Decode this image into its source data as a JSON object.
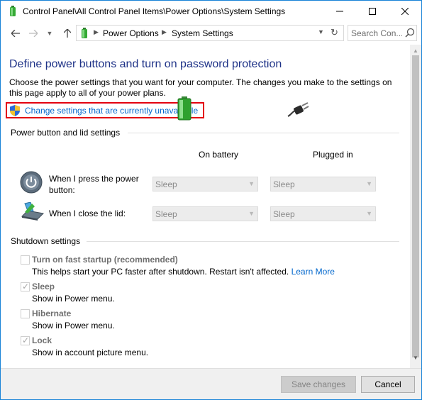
{
  "window": {
    "title": "Control Panel\\All Control Panel Items\\Power Options\\System Settings",
    "controls": {
      "minimize_icon": "minimize-icon",
      "maximize_icon": "maximize-icon",
      "close_icon": "close-icon"
    }
  },
  "address_bar": {
    "crumbs": [
      "Power Options",
      "System Settings"
    ],
    "search_placeholder": "Search Con..."
  },
  "page": {
    "title": "Define power buttons and turn on password protection",
    "description": "Choose the power settings that you want for your computer. The changes you make to the settings on this page apply to all of your power plans.",
    "change_link": "Change settings that are currently unavailable"
  },
  "power_settings": {
    "group_label": "Power button and lid settings",
    "columns": {
      "battery": "On battery",
      "plugged": "Plugged in"
    },
    "rows": [
      {
        "label": "When I press the power button:",
        "on_battery": "Sleep",
        "plugged_in": "Sleep"
      },
      {
        "label": "When I close the lid:",
        "on_battery": "Sleep",
        "plugged_in": "Sleep"
      }
    ]
  },
  "shutdown_settings": {
    "group_label": "Shutdown settings",
    "options": [
      {
        "title": "Turn on fast startup (recommended)",
        "desc": "This helps start your PC faster after shutdown. Restart isn't affected.",
        "link": "Learn More",
        "checked": false
      },
      {
        "title": "Sleep",
        "desc": "Show in Power menu.",
        "checked": true
      },
      {
        "title": "Hibernate",
        "desc": "Show in Power menu.",
        "checked": false
      },
      {
        "title": "Lock",
        "desc": "Show in account picture menu.",
        "checked": true
      }
    ]
  },
  "footer": {
    "save_label": "Save changes",
    "cancel_label": "Cancel"
  },
  "colors": {
    "title_blue": "#1e3287",
    "link_blue": "#0066cc",
    "highlight_red": "#e3000f",
    "window_border": "#1883d7"
  }
}
